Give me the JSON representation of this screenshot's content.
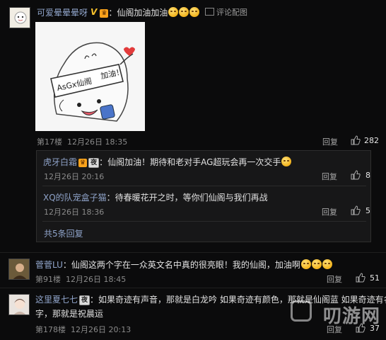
{
  "comments": [
    {
      "user": "可爱晕晕晕呀",
      "user_badges": [
        "V"
      ],
      "text": "：仙阁加油加油",
      "reply_link": "评论配图",
      "floor": "第17楼",
      "date": "12月26日",
      "time": "18:35",
      "reply_label": "回复",
      "likes": "282"
    },
    {
      "user": "菅菅LU",
      "text": "：仙阁这两个字在一众英文名中真的很亮眼！我的仙阁，加油啊",
      "floor": "第91楼",
      "date": "12月26日",
      "time": "18:45",
      "reply_label": "回复",
      "likes": "51"
    },
    {
      "user": "这里夏七七",
      "user_badges": [
        "夜"
      ],
      "text_line1": "：如果奇迹有声音，那就是白龙吟 如果奇迹有颜色，那就是仙阁蓝 如果奇迹有名",
      "text_line2": "字，那就是祝晨运",
      "floor": "第178楼",
      "date": "12月26日",
      "time": "20:13",
      "reply_label": "回复",
      "likes": "37"
    }
  ],
  "sub_replies": [
    {
      "user": "虎牙白霜",
      "user_badges": [
        "夜"
      ],
      "text": "：仙阁加油！期待和老对手AG超玩会再一次交手",
      "date": "12月26日",
      "time": "20:16",
      "reply_label": "回复",
      "likes": "8"
    },
    {
      "user": "XQ的队宠盒子猫",
      "text": "：待春暖花开之时，等你们仙阁与我们再战",
      "date": "12月26日",
      "time": "18:36",
      "reply_label": "回复",
      "likes": "5"
    }
  ],
  "more_replies": "共5条回复",
  "image_text": {
    "headband_left": "AsGx仙阁",
    "headband_right": "加油！"
  },
  "watermark": "叨游网",
  "colors": {
    "background": "#0b0b0c",
    "username": "#8fa3c9",
    "meta": "#8a8a8a"
  }
}
